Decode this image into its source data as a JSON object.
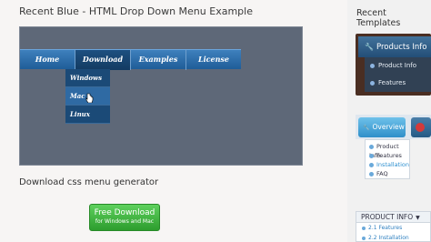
{
  "page": {
    "title": "Recent Blue - HTML Drop Down Menu Example",
    "section_title": "Download css menu generator",
    "free_download": {
      "line1": "Free Download",
      "line2": "for Windows and Mac"
    }
  },
  "demo_menu": {
    "items": [
      "Home",
      "Download",
      "Examples",
      "License"
    ],
    "active_index": 1,
    "dropdown": [
      "Windows",
      "Mac",
      "Linux"
    ],
    "hover_index": 1
  },
  "sidebar": {
    "title": "Recent Templates",
    "template1": {
      "header": "Products Info",
      "items": [
        "Product Info",
        "Features"
      ]
    },
    "template2": {
      "tab": "Overview",
      "items": [
        "Product Info",
        "Features",
        "Installation",
        "FAQ"
      ],
      "selected_index": 2
    },
    "template3": {
      "header": "PRODUCT INFO",
      "items": [
        "2.1 Features",
        "2.2 Installation"
      ]
    }
  },
  "colors": {
    "menu_blue": "#2a6aa8",
    "demo_bg": "#5e6878",
    "download_green": "#3cae3c"
  }
}
